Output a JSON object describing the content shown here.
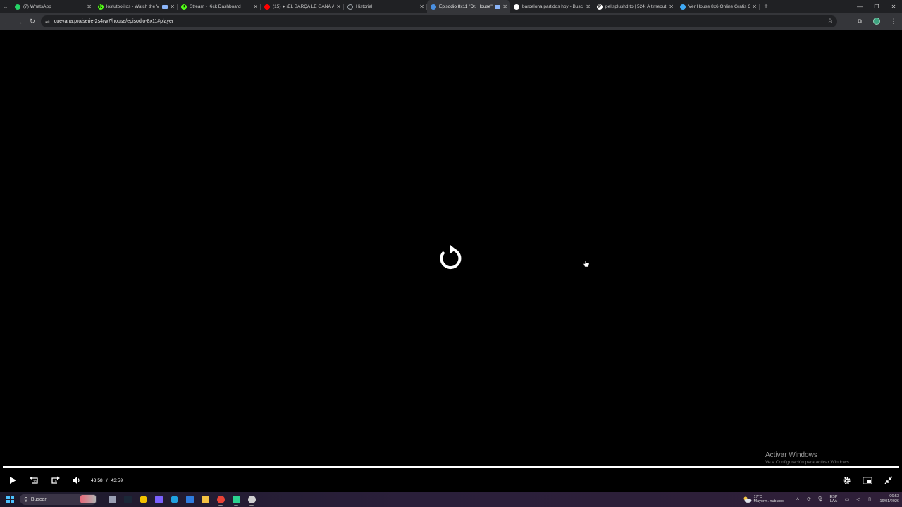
{
  "browser": {
    "tabs": [
      {
        "title": "(7) WhatsApp",
        "favicon_color": "#25D366",
        "icon": "whatsapp-icon"
      },
      {
        "title": "losfutbolitos - Watch the V",
        "favicon_color": "#53FC18",
        "icon": "kick-icon",
        "glyph": "K",
        "extra_icon": "screen-share-icon"
      },
      {
        "title": "Stream - Kick Dashboard",
        "favicon_color": "#53FC18",
        "icon": "kick-icon",
        "glyph": "K"
      },
      {
        "title": "(15) ● ¡EL BARÇA LE GANA A",
        "favicon_color": "#FF0000",
        "icon": "youtube-icon"
      },
      {
        "title": "Historial",
        "favicon_color": "#9aa0a6",
        "icon": "history-icon"
      },
      {
        "title": "Episodio 8x11 \"Dr. House\"",
        "favicon_color": "#4a90e2",
        "icon": "site-icon",
        "active": true,
        "extra_icon": "screen-share-icon"
      },
      {
        "title": "barcelona partidos hoy - Busca",
        "favicon_color": "#ffffff",
        "icon": "google-icon"
      },
      {
        "title": "pelisplushd.to | 524: A timeout",
        "favicon_color": "#ffffff",
        "icon": "pelisplus-icon",
        "glyph": "P"
      },
      {
        "title": "Ver House 8x6 Online Gratis Cu",
        "favicon_color": "#3fa9f5",
        "icon": "site-icon"
      }
    ],
    "new_tab_symbol": "+",
    "url": "cuevana.pro/serie-2s4rw7/house/episodio-8x11#player"
  },
  "player": {
    "current_time": "43:58",
    "time_separator": "/",
    "duration": "43:59",
    "progress_fraction": 1.0,
    "center_icon": "replay-icon"
  },
  "watermark": {
    "title": "Activar Windows",
    "subtitle": "Ve a Configuración para activar Windows."
  },
  "taskbar": {
    "search_placeholder": "Buscar",
    "apps": [
      {
        "name": "file-manager",
        "color": "#9aa0b4"
      },
      {
        "name": "steam",
        "color": "#1b2838"
      },
      {
        "name": "norton",
        "color": "#f2c200"
      },
      {
        "name": "copilot",
        "color": "#7b61ff"
      },
      {
        "name": "edge",
        "color": "#1fa1e0"
      },
      {
        "name": "store",
        "color": "#2f7de1"
      },
      {
        "name": "explorer",
        "color": "#f5c242"
      },
      {
        "name": "chrome",
        "color": "#e94235",
        "running": true
      },
      {
        "name": "app-green",
        "color": "#2bd28f",
        "running": true
      },
      {
        "name": "obs",
        "color": "#cfcfcf",
        "running": true
      }
    ],
    "weather_temp": "17°C",
    "weather_desc": "Mayorm. nublado",
    "lang_line1": "ESP",
    "lang_line2": "LAA",
    "time": "06:53",
    "date": "16/01/2026"
  }
}
